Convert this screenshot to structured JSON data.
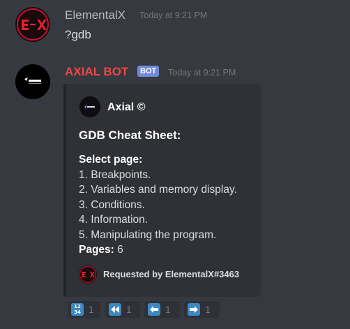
{
  "messages": [
    {
      "username": "ElementalX",
      "timestamp": "Today at 9:21 PM",
      "content": "?gdb"
    },
    {
      "username": "AXIAL BOT",
      "bot_tag": "BOT",
      "timestamp": "Today at 9:21 PM",
      "embed": {
        "author": "Axial ©",
        "title": "GDB Cheat Sheet:",
        "select_label": "Select page:",
        "items": [
          "1. Breakpoints.",
          "2. Variables and memory display.",
          "3. Conditions.",
          "4. Information.",
          "5. Manipulating the program."
        ],
        "pages_label": "Pages:",
        "pages_value": " 6",
        "footer": "Requested by ElementalX#3463"
      }
    }
  ],
  "reactions": [
    {
      "icon": "input-numbers-icon",
      "symbol": "1234",
      "count": "1"
    },
    {
      "icon": "rewind-icon",
      "symbol": "⏪",
      "count": "1"
    },
    {
      "icon": "arrow-left-icon",
      "symbol": "⬅",
      "count": "1"
    },
    {
      "icon": "arrow-right-icon",
      "symbol": "➡",
      "count": "1"
    }
  ],
  "colors": {
    "background": "#36393f",
    "embed_bg": "#2f3136",
    "bot_name": "#f04747",
    "bot_tag": "#7289da",
    "reaction_blue": "#3b88c3"
  }
}
